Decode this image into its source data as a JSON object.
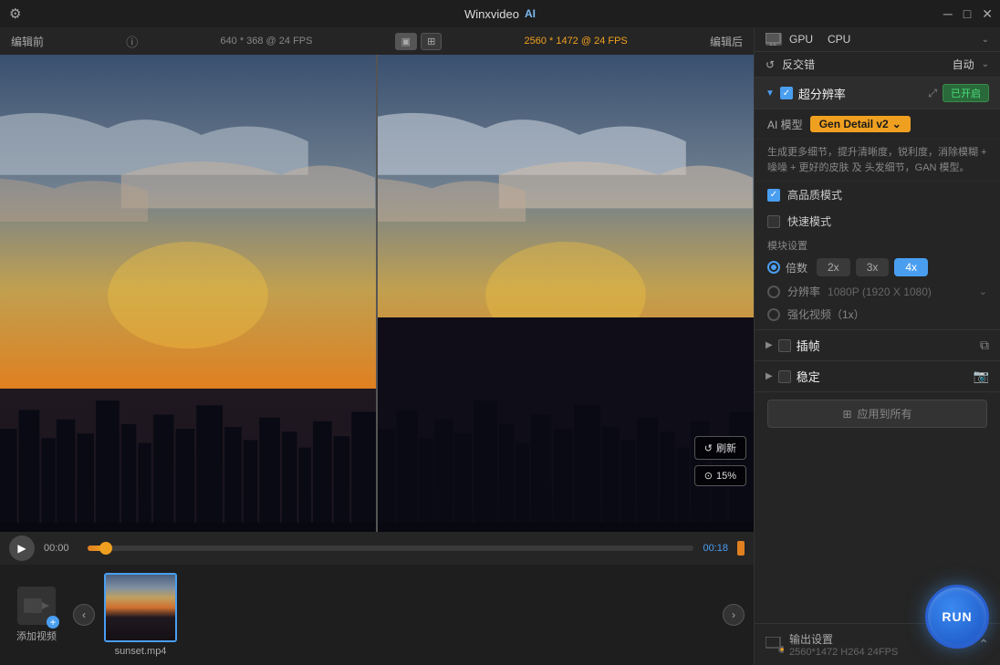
{
  "titlebar": {
    "title": "Winxvideo",
    "ai_label": "AI",
    "settings_icon": "⚙",
    "min_icon": "─",
    "max_icon": "□",
    "close_icon": "✕"
  },
  "video_topbar": {
    "left_label": "编辑前",
    "info_icon": "ⓘ",
    "left_res": "640 * 368 @ 24 FPS",
    "right_res": "2560 * 1472 @ 24 FPS",
    "right_label": "编辑后",
    "view_btn1": "▣",
    "view_btn2": "⊞"
  },
  "video_controls": {
    "refresh_label": "刷新",
    "zoom_label": "15%"
  },
  "playback": {
    "play_icon": "▶",
    "time_start": "00:00",
    "time_end": "00:18"
  },
  "thumbnail": {
    "add_label": "添加视频",
    "nav_left": "‹",
    "nav_right": "›",
    "file_name": "sunset.mp4"
  },
  "right_panel": {
    "gpu_label": "GPU",
    "cpu_label": "CPU",
    "anti_icon": "↺",
    "anti_label": "反交错",
    "anti_value": "自动",
    "super_res": {
      "title": "超分辨率",
      "on_label": "已开启",
      "ai_model_label": "AI 模型",
      "model_name": "Gen Detail v2",
      "description": "生成更多细节，提升清晰度，锐利度，消除模糊 + 噪噪 + 更好的皮肤 及 头发细节，GAN 模型。",
      "quality_mode": "高品质模式",
      "fast_mode": "快速模式",
      "module_settings": "模块设置",
      "multiplier_label": "倍数",
      "mult_2x": "2x",
      "mult_3x": "3x",
      "mult_4x": "4x",
      "resolution_label": "分辨率",
      "resolution_value": "1080P (1920 X 1080)",
      "enhance_label": "强化视频（1x）"
    },
    "interpolation": {
      "title": "插帧"
    },
    "stabilization": {
      "title": "稳定"
    },
    "apply_all": "应用到所有",
    "output": {
      "title": "输出设置",
      "detail": "2560*1472  H264  24FPS"
    }
  },
  "run_button": "RUN"
}
